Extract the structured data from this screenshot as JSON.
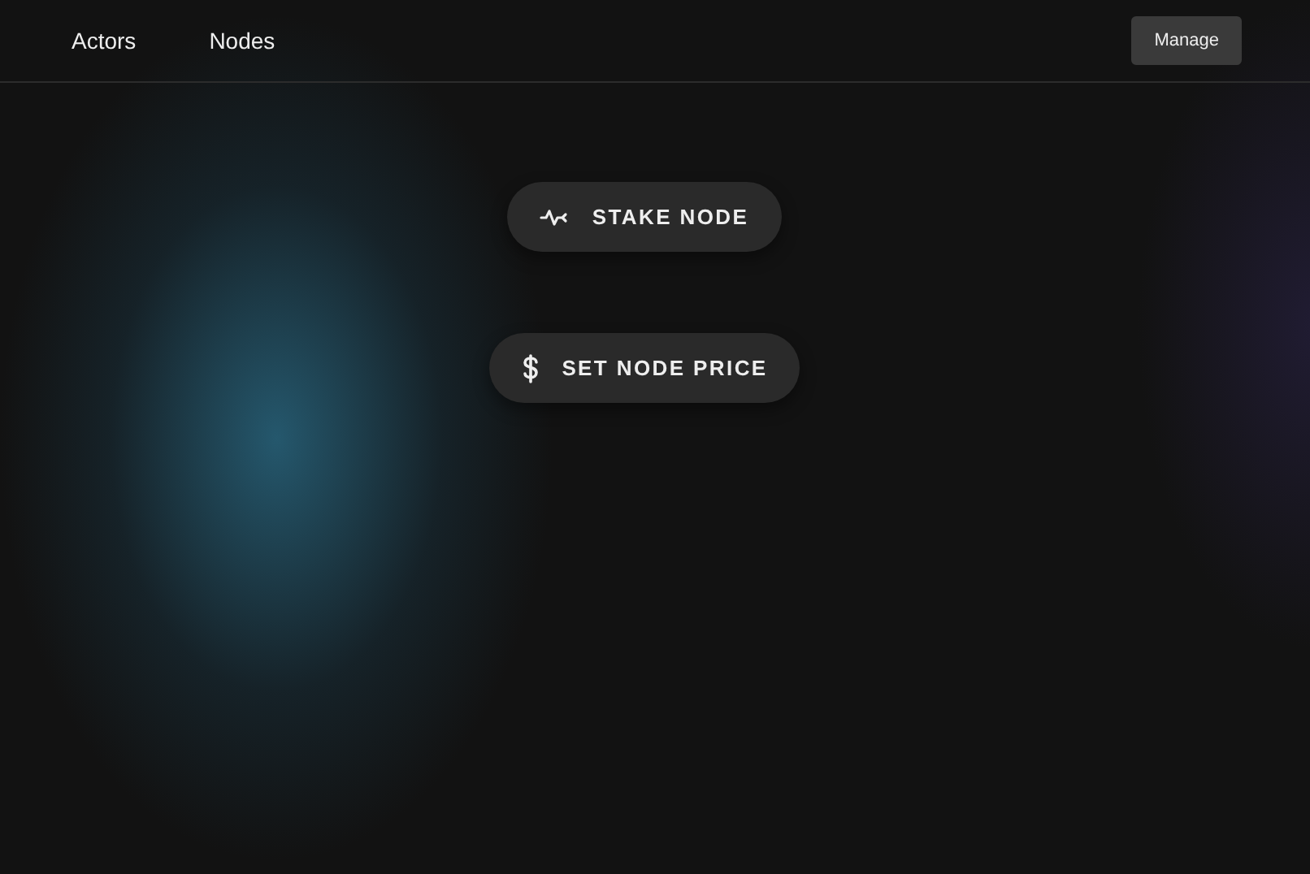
{
  "nav": {
    "links": [
      "Actors",
      "Nodes"
    ],
    "manage_button": "Manage"
  },
  "actions": [
    {
      "label": "STAKE NODE",
      "kind": "stake"
    },
    {
      "label": "SET NODE PRICE",
      "kind": "price"
    }
  ]
}
